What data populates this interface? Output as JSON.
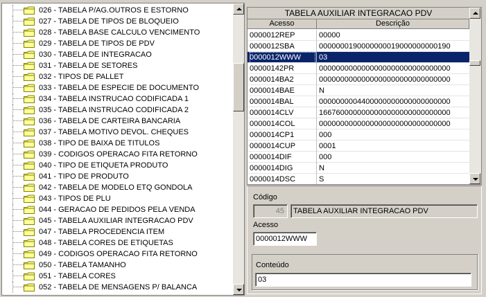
{
  "tree": {
    "items": [
      "026 - TABELA P/AG.OUTROS E ESTORNO",
      "027 - TABELA DE TIPOS DE BLOQUEIO",
      "028 - TABELA BASE CALCULO VENCIMENTO",
      "029 - TABELA DE TIPOS DE PDV",
      "030 - TABELA DE INTEGRACAO",
      "031 - TABELA DE SETORES",
      "032 - TIPOS DE PALLET",
      "033 - TABELA DE ESPECIE DE DOCUMENTO",
      "034 - TABELA INSTRUCAO CODIFICADA 1",
      "035 - TABELA INSTRUCAO CODIFICADA 2",
      "036 - TABELA DE CARTEIRA BANCARIA",
      "037 - TABELA MOTIVO DEVOL. CHEQUES",
      "038 - TIPO DE BAIXA DE TITULOS",
      "039 - CODIGOS OPERACAO FITA RETORNO",
      "040 - TIPO DE ETIQUETA PRODUTO",
      "041 - TIPO DE PRODUTO",
      "042 - TABELA DE MODELO ETQ GONDOLA",
      "043 - TIPOS DE PLU",
      "044 - GERACAO DE PEDIDOS PELA VENDA",
      "045 - TABELA AUXILIAR INTEGRACAO PDV",
      "047 - TABELA PROCEDENCIA ITEM",
      "048 - TABELA CORES DE ETIQUETAS",
      "049 - CODIGOS OPERACAO FITA RETORNO",
      "050 - TABELA TAMANHO",
      "051 - TABELA CORES",
      "052 - TABELA DE MENSAGENS P/ BALANCA"
    ]
  },
  "grid": {
    "title": "TABELA AUXILIAR INTEGRACAO PDV",
    "col_acesso": "Acesso",
    "col_descricao": "Descrição",
    "rows": [
      {
        "acesso": "0000012REP",
        "descricao": "00000"
      },
      {
        "acesso": "0000012SBA",
        "descricao": "0000000190000000019000000000190"
      },
      {
        "acesso": "0000012WWW",
        "descricao": "03"
      },
      {
        "acesso": "00000142PR",
        "descricao": "0000000000000000000000000000000"
      },
      {
        "acesso": "0000014BA2",
        "descricao": "0000000000000000000000000000000"
      },
      {
        "acesso": "0000014BAE",
        "descricao": "N"
      },
      {
        "acesso": "0000014BAL",
        "descricao": "0000000004400000000000000000000"
      },
      {
        "acesso": "0000014CLV",
        "descricao": "1667600000000000000000000000000"
      },
      {
        "acesso": "0000014COL",
        "descricao": "0000000000000000000000000000000"
      },
      {
        "acesso": "0000014CP1",
        "descricao": "000"
      },
      {
        "acesso": "0000014CUP",
        "descricao": "0001"
      },
      {
        "acesso": "0000014DIF",
        "descricao": "000"
      },
      {
        "acesso": "0000014DIG",
        "descricao": "N"
      },
      {
        "acesso": "0000014DSC",
        "descricao": "S"
      }
    ]
  },
  "form": {
    "codigo_label": "Código",
    "codigo_value": "45",
    "codigo_desc": "TABELA AUXILIAR INTEGRACAO PDV",
    "acesso_label": "Acesso",
    "acesso_value": "0000012WWW",
    "conteudo_label": "Conteúdo",
    "conteudo_value": "03"
  },
  "colors": {
    "selection": "#0a246a",
    "window": "#d4d0c8"
  }
}
